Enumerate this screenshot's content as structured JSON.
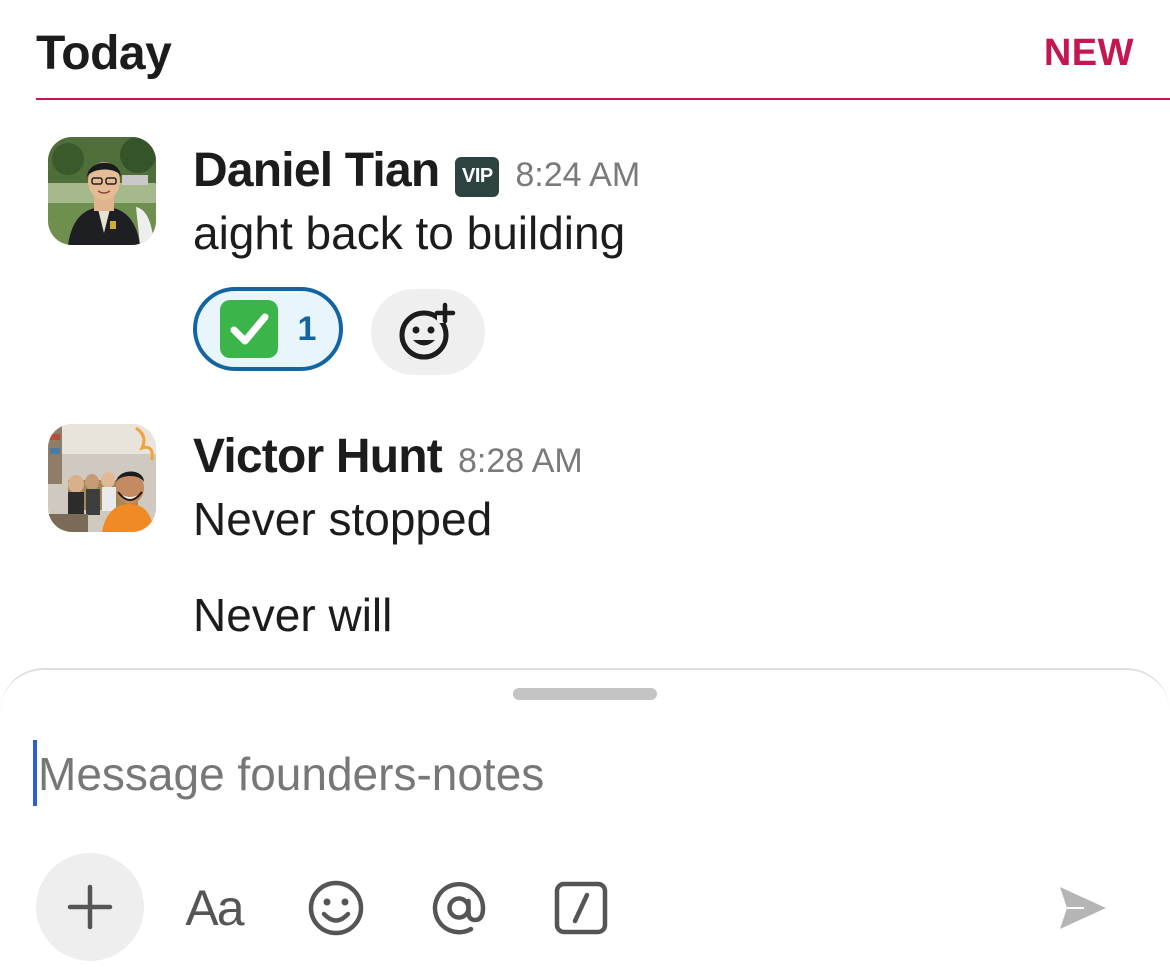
{
  "header": {
    "title": "Today",
    "new_label": "NEW"
  },
  "messages": [
    {
      "author": "Daniel Tian",
      "badge": "VIP",
      "time": "8:24 AM",
      "lines": [
        "aight back to building"
      ],
      "reactions": [
        {
          "emoji": "white-check-mark",
          "count": "1"
        }
      ]
    },
    {
      "author": "Victor Hunt",
      "time": "8:28 AM",
      "lines": [
        "Never stopped",
        "Never will"
      ]
    }
  ],
  "composer": {
    "placeholder": "Message founders-notes",
    "toolbar": [
      {
        "icon": "plus-icon"
      },
      {
        "label": "Aa",
        "icon": "text-format-icon"
      },
      {
        "icon": "emoji-icon"
      },
      {
        "icon": "mention-icon"
      },
      {
        "icon": "slash-command-icon"
      },
      {
        "icon": "send-icon"
      }
    ]
  },
  "colors": {
    "accent_new": "#c5174f",
    "reaction_border": "#1264a3",
    "reaction_bg": "#e8f5fa",
    "vip_bg": "#2d4340",
    "caret": "#2a5dd6"
  }
}
